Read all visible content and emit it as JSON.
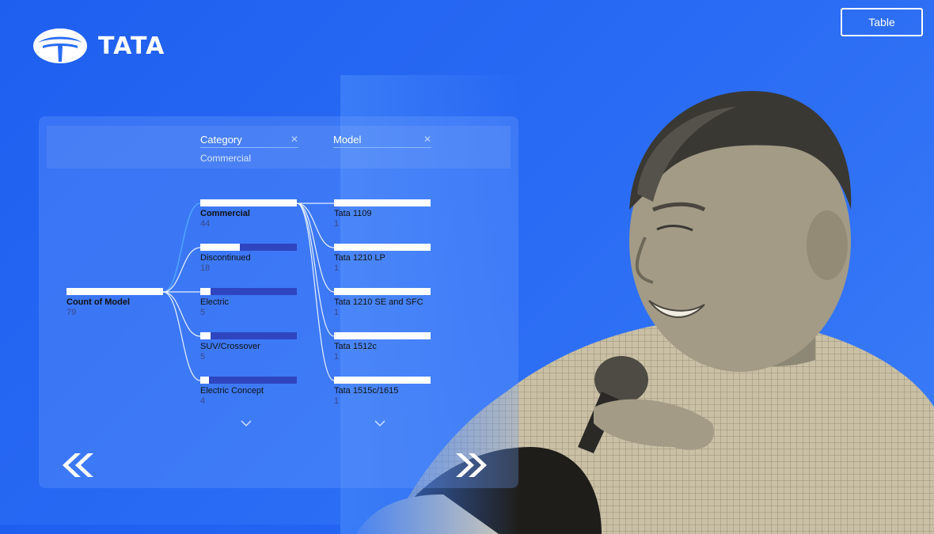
{
  "brand": {
    "logo_text": "TATA",
    "icon": "tata-logo-icon"
  },
  "header": {
    "table_button": "Table"
  },
  "filters": [
    {
      "label": "Category",
      "value": "Commercial"
    },
    {
      "label": "Model",
      "value": ""
    }
  ],
  "tree": {
    "root": {
      "label": "Count of Model",
      "value": "79"
    },
    "categories": [
      {
        "label": "Commercial",
        "value": "44",
        "fill": 1.0
      },
      {
        "label": "Discontinued",
        "value": "18",
        "fill": 0.41
      },
      {
        "label": "Electric",
        "value": "5",
        "fill": 0.11
      },
      {
        "label": "SUV/Crossover",
        "value": "5",
        "fill": 0.11
      },
      {
        "label": "Electric Concept",
        "value": "4",
        "fill": 0.09
      }
    ],
    "models": [
      {
        "label": "Tata 1109",
        "value": "1",
        "fill": 1.0
      },
      {
        "label": "Tata 1210 LP",
        "value": "1",
        "fill": 1.0
      },
      {
        "label": "Tata 1210 SE and SFC",
        "value": "1",
        "fill": 1.0
      },
      {
        "label": "Tata 1512c",
        "value": "1",
        "fill": 1.0
      },
      {
        "label": "Tata 1515c/1615",
        "value": "1",
        "fill": 1.0
      }
    ]
  },
  "colors": {
    "background": "#2a6cf4",
    "bar_track": "#2f45c0",
    "bar_fill": "#ffffff"
  }
}
